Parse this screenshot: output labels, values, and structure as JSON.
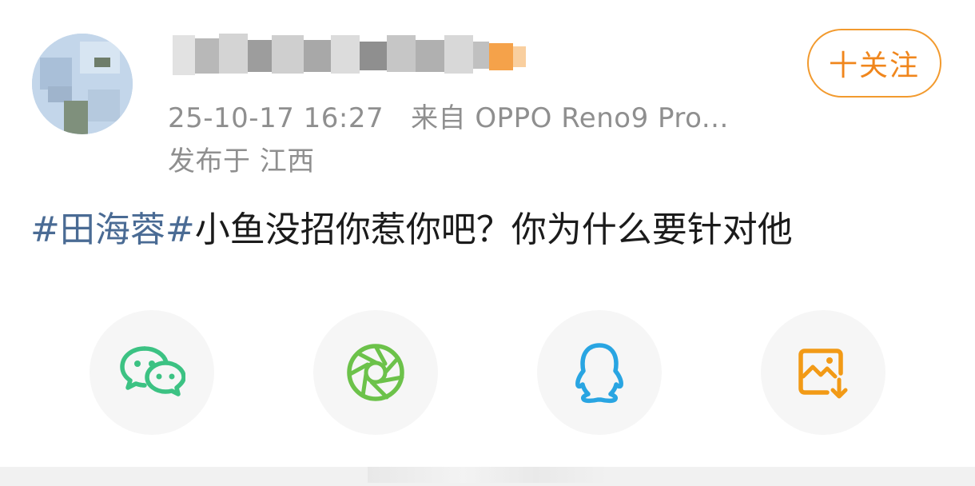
{
  "post": {
    "username_obscured": true,
    "timestamp": "25-10-17 16:27",
    "source": "来自 OPPO Reno9 Pro...",
    "location": "发布于 江西",
    "hashtag": "#田海蓉#",
    "text": "小鱼没招你惹你吧？你为什么要针对他"
  },
  "follow_button": {
    "label": "十关注"
  },
  "share_options": [
    {
      "icon": "wechat-icon",
      "color": "#3cc283"
    },
    {
      "icon": "moments-icon",
      "color": "#6cc24a"
    },
    {
      "icon": "qq-icon",
      "color": "#29a5e2"
    },
    {
      "icon": "save-image-icon",
      "color": "#f29a16"
    }
  ],
  "colors": {
    "accent": "#f0861c",
    "hashtag": "#4a6b94",
    "meta_text": "#8f8f8f"
  }
}
